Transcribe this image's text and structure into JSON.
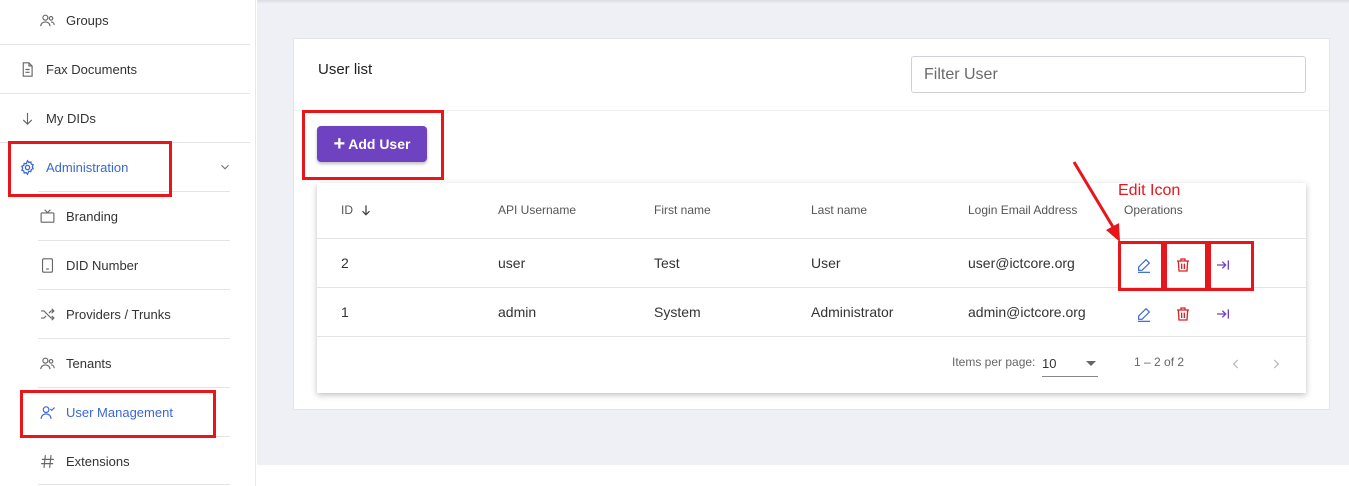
{
  "sidebar": {
    "items": [
      {
        "label": "Groups",
        "icon": "users-icon"
      },
      {
        "label": "Fax Documents",
        "icon": "document-icon"
      },
      {
        "label": "My DIDs",
        "icon": "arrow-down-icon"
      },
      {
        "label": "Administration",
        "icon": "gear-icon"
      },
      {
        "label": "Branding",
        "icon": "tv-icon"
      },
      {
        "label": "DID Number",
        "icon": "phone-icon"
      },
      {
        "label": "Providers / Trunks",
        "icon": "shuffle-icon"
      },
      {
        "label": "Tenants",
        "icon": "users-icon"
      },
      {
        "label": "User Management",
        "icon": "user-check-icon"
      },
      {
        "label": "Extensions",
        "icon": "hash-icon"
      }
    ]
  },
  "card": {
    "title": "User list",
    "filter_placeholder": "Filter User",
    "add_button": "Add User"
  },
  "table": {
    "columns": [
      "ID",
      "API Username",
      "First name",
      "Last name",
      "Login Email Address",
      "Operations"
    ],
    "rows": [
      {
        "id": "2",
        "username": "user",
        "first": "Test",
        "last": "User",
        "email": "user@ictcore.org"
      },
      {
        "id": "1",
        "username": "admin",
        "first": "System",
        "last": "Administrator",
        "email": "admin@ictcore.org"
      }
    ],
    "items_per_page_label": "Items per page:",
    "items_per_page": "10",
    "range": "1 – 2 of 2"
  },
  "annotation": {
    "label": "Edit Icon"
  },
  "colors": {
    "accent": "#6f42c1",
    "active": "#3a66d6",
    "delete": "#d8232a",
    "annotation": "#e8151b"
  }
}
